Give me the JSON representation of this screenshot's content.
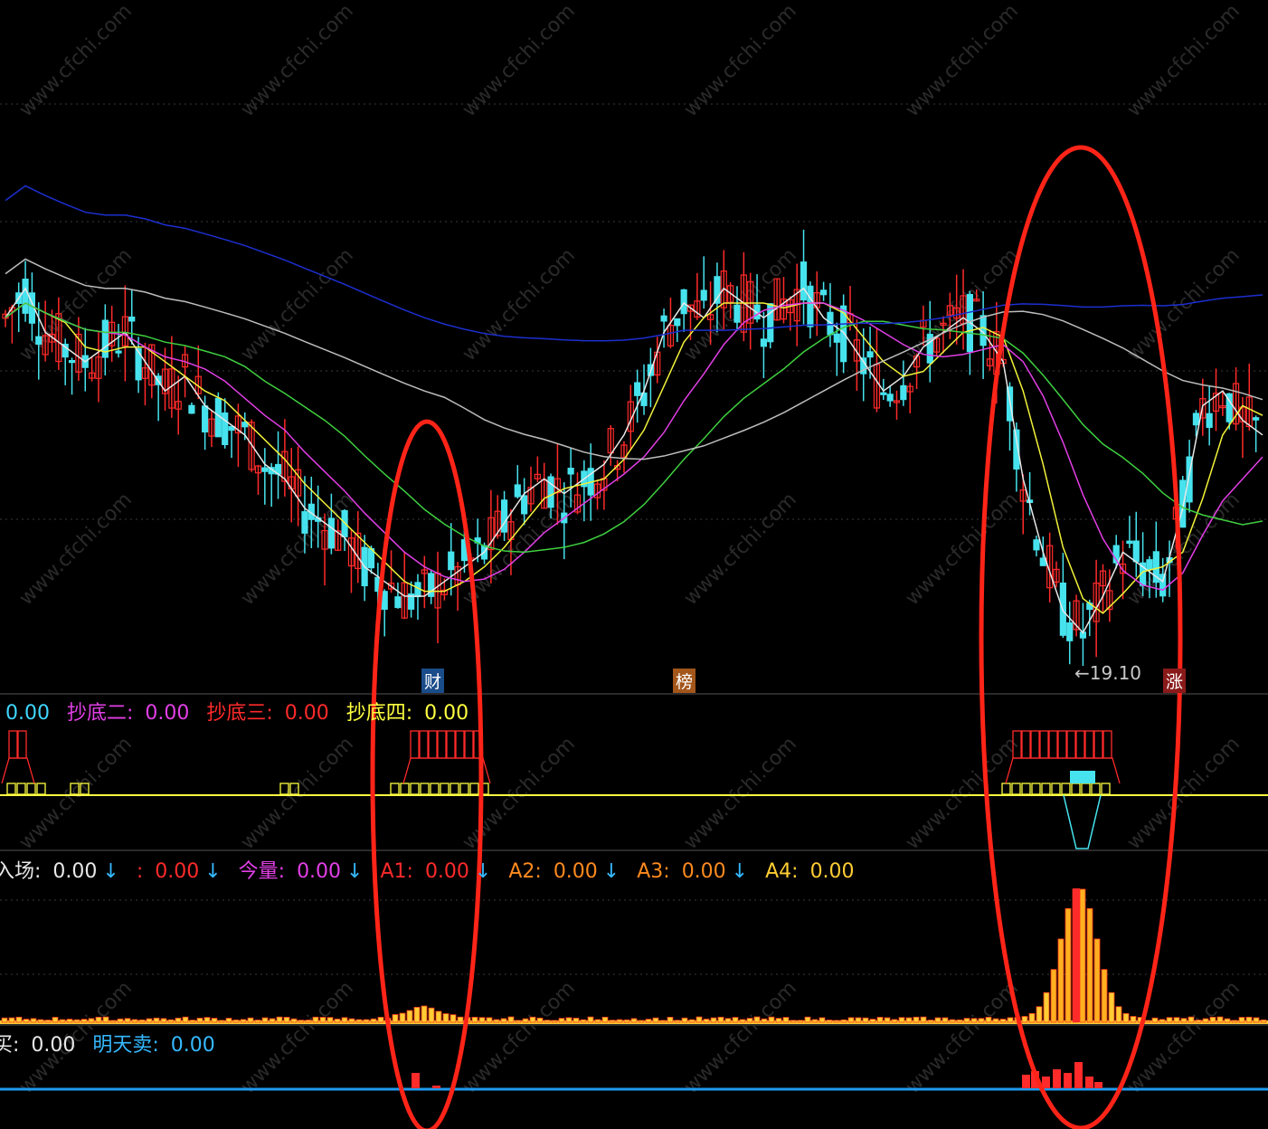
{
  "colors": {
    "background": "#000000",
    "up_candle": "#ff2a2a",
    "down_candle": "#46e3ee",
    "ma_white": "#e8e8e8",
    "ma_yellow": "#f2f23a",
    "ma_magenta": "#e23fe6",
    "ma_green": "#3fcf3f",
    "ma_gray": "#bdbdbd",
    "ma_blue": "#1c2fd0",
    "ellipse": "#ff2418",
    "divider": "#2a2a2a",
    "baseline_yellow": "#ffff40",
    "baseline_blue": "#1e9bf0"
  },
  "markers": {
    "cai": "财",
    "bang": "榜",
    "zhang": "涨",
    "low_label": "←19.10"
  },
  "panel2": {
    "items": [
      {
        "label": "",
        "value": "0.00",
        "color": "#3fd6ff"
      },
      {
        "label": "抄底二: ",
        "value": "0.00",
        "color": "#e23fe6"
      },
      {
        "label": "抄底三: ",
        "value": "0.00",
        "color": "#ff2a2a"
      },
      {
        "label": "抄底四: ",
        "value": "0.00",
        "color": "#ffff40"
      }
    ]
  },
  "panel3": {
    "items": [
      {
        "label": "入场: ",
        "value": "0.00",
        "color": "#e8e8e8",
        "arrow": "↓"
      },
      {
        "label": ": ",
        "value": "0.00",
        "color": "#ff2a2a",
        "arrow": "↓"
      },
      {
        "label": "今量: ",
        "value": "0.00",
        "color": "#e23fe6",
        "arrow": "↓"
      },
      {
        "label": "A1: ",
        "value": "0.00",
        "color": "#ff2a2a",
        "arrow": "↓"
      },
      {
        "label": "A2: ",
        "value": "0.00",
        "color": "#ff8a1e",
        "arrow": "↓"
      },
      {
        "label": "A3: ",
        "value": "0.00",
        "color": "#ff8a1e",
        "arrow": "↓"
      },
      {
        "label": "A4: ",
        "value": "0.00",
        "color": "#ffcc33",
        "arrow": ""
      }
    ]
  },
  "panel4": {
    "items": [
      {
        "label": "买: ",
        "value": "0.00",
        "color": "#e8e8e8"
      },
      {
        "label": "明天卖: ",
        "value": "0.00",
        "color": "#35b9ff"
      }
    ]
  },
  "chart_data": {
    "type": "candlestick",
    "low_value": 19.1,
    "close_series": [
      [
        "s0",
        41
      ],
      [
        "s1",
        43
      ],
      [
        "s2",
        40
      ],
      [
        "s3",
        39
      ],
      [
        "s4",
        38
      ],
      [
        "s5",
        39
      ],
      [
        "s6",
        40
      ],
      [
        "s7",
        38
      ],
      [
        "s8",
        36
      ],
      [
        "s9",
        37
      ],
      [
        "s10",
        35
      ],
      [
        "s11",
        34
      ],
      [
        "s12",
        33
      ],
      [
        "s13",
        31
      ],
      [
        "s14",
        30
      ],
      [
        "s15",
        28
      ],
      [
        "s16",
        27
      ],
      [
        "s17",
        26
      ],
      [
        "s18",
        24
      ],
      [
        "s19",
        23
      ],
      [
        "s20",
        22
      ],
      [
        "s21",
        22
      ],
      [
        "s22",
        23
      ],
      [
        "s23",
        24
      ],
      [
        "s24",
        25
      ],
      [
        "s25",
        27
      ],
      [
        "s26",
        29
      ],
      [
        "s27",
        30
      ],
      [
        "s28",
        29
      ],
      [
        "s29",
        30
      ],
      [
        "s30",
        31
      ],
      [
        "s31",
        33
      ],
      [
        "s32",
        36
      ],
      [
        "s33",
        40
      ],
      [
        "s34",
        42
      ],
      [
        "s35",
        41
      ],
      [
        "s36",
        43
      ],
      [
        "s37",
        42
      ],
      [
        "s38",
        41
      ],
      [
        "s39",
        42
      ],
      [
        "s40",
        43
      ],
      [
        "s41",
        41
      ],
      [
        "s42",
        40
      ],
      [
        "s43",
        38
      ],
      [
        "s44",
        36
      ],
      [
        "s45",
        37
      ],
      [
        "s46",
        39
      ],
      [
        "s47",
        40
      ],
      [
        "s48",
        41
      ],
      [
        "s49",
        40
      ],
      [
        "s50",
        38
      ],
      [
        "s51",
        30
      ],
      [
        "s52",
        25
      ],
      [
        "s53",
        21
      ],
      [
        "s54",
        19.5
      ],
      [
        "s55",
        22
      ],
      [
        "s56",
        25
      ],
      [
        "s57",
        24
      ],
      [
        "s58",
        23
      ],
      [
        "s59",
        28
      ],
      [
        "s60",
        35
      ],
      [
        "s61",
        36
      ],
      [
        "s62",
        34
      ],
      [
        "s63",
        33
      ]
    ]
  }
}
